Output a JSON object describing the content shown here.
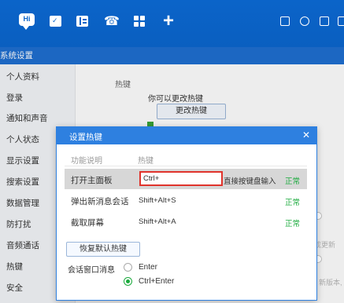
{
  "toolbar": {
    "icons": [
      "chat-icon",
      "calendar-icon",
      "contacts-icon",
      "phone-icon",
      "apps-icon",
      "plus-icon",
      "window-icon",
      "clock-icon",
      "folder-icon",
      "cube-icon"
    ],
    "chat_badge": "Hi",
    "accent": "#0b64c9"
  },
  "sidebar": {
    "title": "系统设置",
    "items": [
      {
        "label": "个人资料"
      },
      {
        "label": "登录"
      },
      {
        "label": "通知和声音"
      },
      {
        "label": "个人状态"
      },
      {
        "label": "显示设置"
      },
      {
        "label": "搜索设置"
      },
      {
        "label": "数据管理"
      },
      {
        "label": "防打扰"
      },
      {
        "label": "音频通话"
      },
      {
        "label": "热键"
      },
      {
        "label": "安全"
      }
    ]
  },
  "main": {
    "section_title": "热键",
    "subtitle": "你可以更改热键",
    "change_button": "更改热键",
    "bg_text_1": "成更新",
    "bg_text_2": "新版本,"
  },
  "dialog": {
    "title": "设置热键",
    "close_label": "✕",
    "columns": [
      "功能说明",
      "热键"
    ],
    "rows": [
      {
        "function": "打开主面板",
        "key": "Ctrl+",
        "hint": "直接按键盘输入",
        "status": "正常",
        "selected": true
      },
      {
        "function": "弹出新消息会话",
        "key": "Shift+Alt+S",
        "status": "正常",
        "selected": false
      },
      {
        "function": "截取屏幕",
        "key": "Shift+Alt+A",
        "status": "正常",
        "selected": false
      }
    ],
    "restore_button": "恢复默认热键",
    "send_label": "会话窗口消息",
    "send_options": [
      {
        "label": "Enter",
        "selected": false
      },
      {
        "label": "Ctrl+Enter",
        "selected": true
      }
    ],
    "status_color": "#1aaa3c",
    "highlight_color": "#e0332b"
  }
}
